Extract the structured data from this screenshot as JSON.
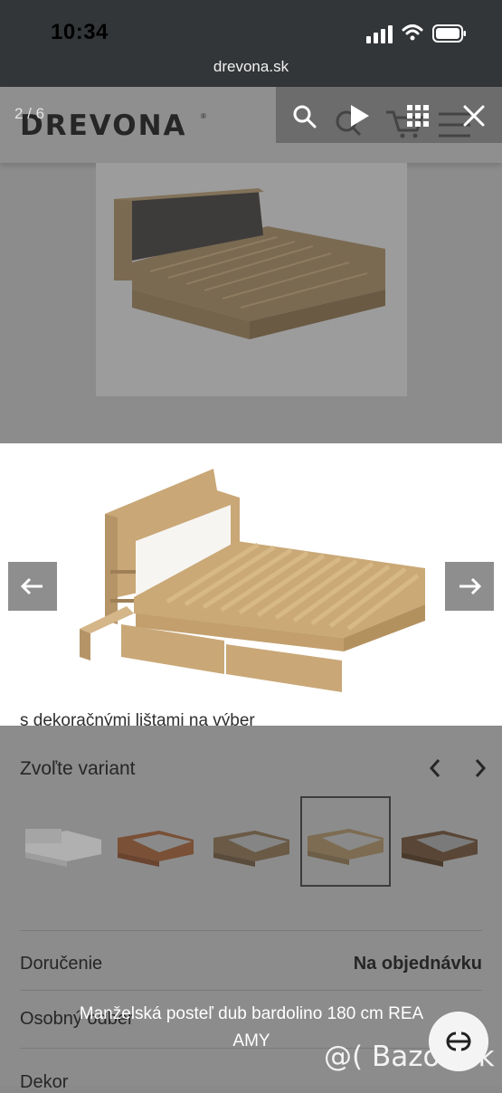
{
  "status_bar": {
    "time": "10:34",
    "url": "drevona.sk",
    "signal_icon": "cellular-signal-icon",
    "wifi_icon": "wifi-icon",
    "battery_icon": "battery-icon"
  },
  "site": {
    "logo": "DREVONA",
    "logo_mark": "®",
    "tagline": "s dekoračnými lištami na výber"
  },
  "lightbox": {
    "counter": "2 / 6",
    "search_icon": "zoom-icon",
    "play_icon": "play-icon",
    "grid_icon": "thumbnails-grid-icon",
    "close_icon": "close-icon",
    "prev_icon": "arrow-left-icon",
    "next_icon": "arrow-right-icon"
  },
  "variants": {
    "title": "Zvoľte variant",
    "options": [
      "white",
      "cherry",
      "dark-oak-grey",
      "bardolino-oak",
      "walnut"
    ],
    "selected_index": 3
  },
  "details": {
    "delivery_label": "Doručenie",
    "delivery_value": "Na objednávku",
    "pickup_label": "Osobný odber",
    "decor_label": "Dekor"
  },
  "ad": {
    "caption_line1": "Manželská posteľ dub bardolino 180 cm REA",
    "caption_line2": "AMY",
    "watermark": "@( Bazos.sk",
    "share_icon": "share-circle-icon"
  },
  "colors": {
    "overlay": "#8c8c8c",
    "status_bar": "#333638",
    "wood": "#c9a777"
  }
}
